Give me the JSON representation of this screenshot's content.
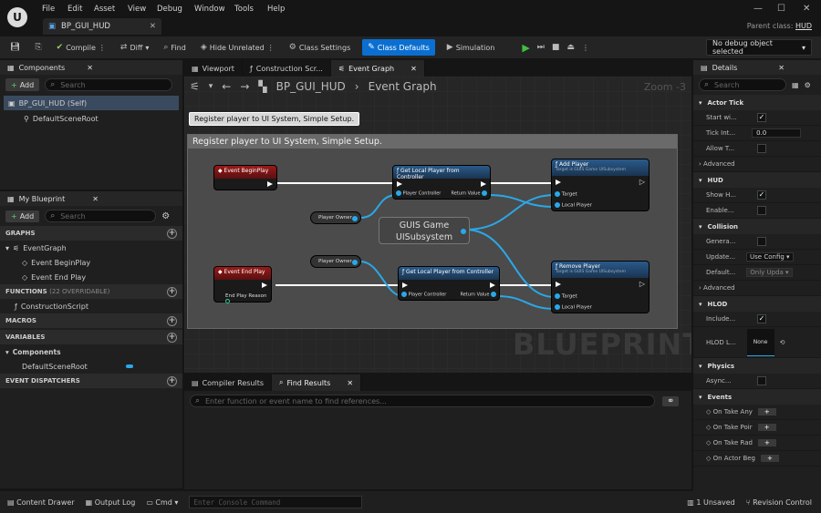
{
  "menu": {
    "items": [
      "File",
      "Edit",
      "Asset",
      "View",
      "Debug",
      "Window",
      "Tools",
      "Help"
    ]
  },
  "asset_tab": {
    "title": "BP_GUI_HUD"
  },
  "parent": {
    "label": "Parent class:",
    "value": "HUD"
  },
  "toolbar": {
    "compile": "Compile",
    "diff": "Diff",
    "find": "Find",
    "hide_unrelated": "Hide Unrelated",
    "class_settings": "Class Settings",
    "class_defaults": "Class Defaults",
    "simulation": "Simulation",
    "debug_object": "No debug object selected"
  },
  "components": {
    "title": "Components",
    "add": "Add",
    "search_placeholder": "Search",
    "root": "BP_GUI_HUD (Self)",
    "child": "DefaultSceneRoot"
  },
  "blueprint": {
    "title": "My Blueprint",
    "add": "Add",
    "search_placeholder": "Search",
    "graphs": "GRAPHS",
    "event_graph": "EventGraph",
    "begin_play": "Event BeginPlay",
    "end_play": "Event End Play",
    "functions": "FUNCTIONS",
    "functions_note": "(22 OVERRIDABLE)",
    "construction": "ConstructionScript",
    "macros": "MACROS",
    "variables": "VARIABLES",
    "comp_cat": "Components",
    "var_root": "DefaultSceneRoot",
    "dispatchers": "EVENT DISPATCHERS"
  },
  "graph_tabs": {
    "viewport": "Viewport",
    "construction": "Construction Scr...",
    "event_graph": "Event Graph"
  },
  "graph": {
    "breadcrumb_bp": "BP_GUI_HUD",
    "breadcrumb_graph": "Event Graph",
    "zoom": "Zoom -3",
    "tooltip": "Register player to UI System, Simple Setup.",
    "comment": "Register player to UI System, Simple Setup.",
    "watermark": "BLUEPRINT",
    "begin_play": "Event BeginPlay",
    "end_play": "Event End Play",
    "end_reason": "End Play Reason",
    "get_lpc1": "Get Local Player from Controller",
    "get_lpc2": "Get Local Player from Controller",
    "player_controller": "Player Controller",
    "return_value": "Return Value",
    "player_owner": "Player Owner",
    "subsystem_l1": "GUIS Game",
    "subsystem_l2": "UISubsystem",
    "add_player": "Add Player",
    "add_player_sub": "Target is GUIS Game UISubsystem",
    "remove_player": "Remove Player",
    "remove_player_sub": "Target is GUIS Game UISubsystem",
    "target": "Target",
    "local_player": "Local Player"
  },
  "results": {
    "compiler": "Compiler Results",
    "find": "Find Results",
    "placeholder": "Enter function or event name to find references..."
  },
  "details": {
    "title": "Details",
    "search_placeholder": "Search",
    "actor_tick": "Actor Tick",
    "start_wi": "Start wi...",
    "tick_int": "Tick Int...",
    "tick_val": "0.0",
    "allow_t": "Allow T...",
    "advanced": "Advanced",
    "hud": "HUD",
    "show_h": "Show H...",
    "enable": "Enable...",
    "collision": "Collision",
    "genera": "Genera...",
    "update": "Update...",
    "update_val": "Use Config",
    "default": "Default...",
    "default_val": "Only Upda",
    "hlod": "HLOD",
    "include": "Include...",
    "hlod_l": "HLOD L...",
    "hlod_none": "None",
    "physics": "Physics",
    "async": "Async...",
    "events": "Events",
    "ev1": "On Take Any",
    "ev2": "On Take Poir",
    "ev3": "On Take Rad",
    "ev4": "On Actor Beg"
  },
  "status": {
    "content_drawer": "Content Drawer",
    "output_log": "Output Log",
    "cmd": "Cmd",
    "console_placeholder": "Enter Console Command",
    "unsaved": "1 Unsaved",
    "revision": "Revision Control"
  }
}
